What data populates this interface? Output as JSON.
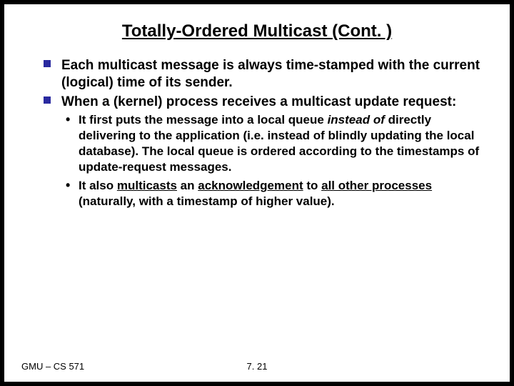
{
  "title": "Totally-Ordered Multicast (Cont. )",
  "bullets": {
    "b1": "Each multicast message is always  time-stamped with the current (logical) time of its sender.",
    "b2": "When a  (kernel) process receives a multicast update request:",
    "s1_a": "It  first puts the message  into a local queue ",
    "s1_b": "instead of",
    "s1_c": "  directly delivering  to the application (i.e. instead of  blindly updating  the local database). The local queue is ordered according to the timestamps of update-request messages.",
    "s2_a": "It also ",
    "s2_b": "multicasts",
    "s2_c": " an ",
    "s2_d": "acknowledgement",
    "s2_e": " to ",
    "s2_f": "all  other processes",
    "s2_g": " (naturally, with a timestamp of higher value)."
  },
  "footer": {
    "left": "GMU – CS 571",
    "center": "7. 21"
  }
}
